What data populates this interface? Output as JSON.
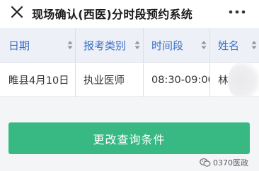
{
  "window": {
    "title": "现场确认(西医)分时段预约系统"
  },
  "table": {
    "columns": [
      "日期",
      "报考类别",
      "时间段",
      "姓名"
    ],
    "rows": [
      [
        "睢县4月10日",
        "执业医师",
        "08:30-09:00",
        "林"
      ]
    ]
  },
  "actions": {
    "change_query_label": "更改查询条件"
  },
  "watermark": {
    "text": "0370医政"
  },
  "colors": {
    "header_text": "#3a6fc4",
    "header_bg": "#eef0f8",
    "button_bg": "#38b984"
  }
}
